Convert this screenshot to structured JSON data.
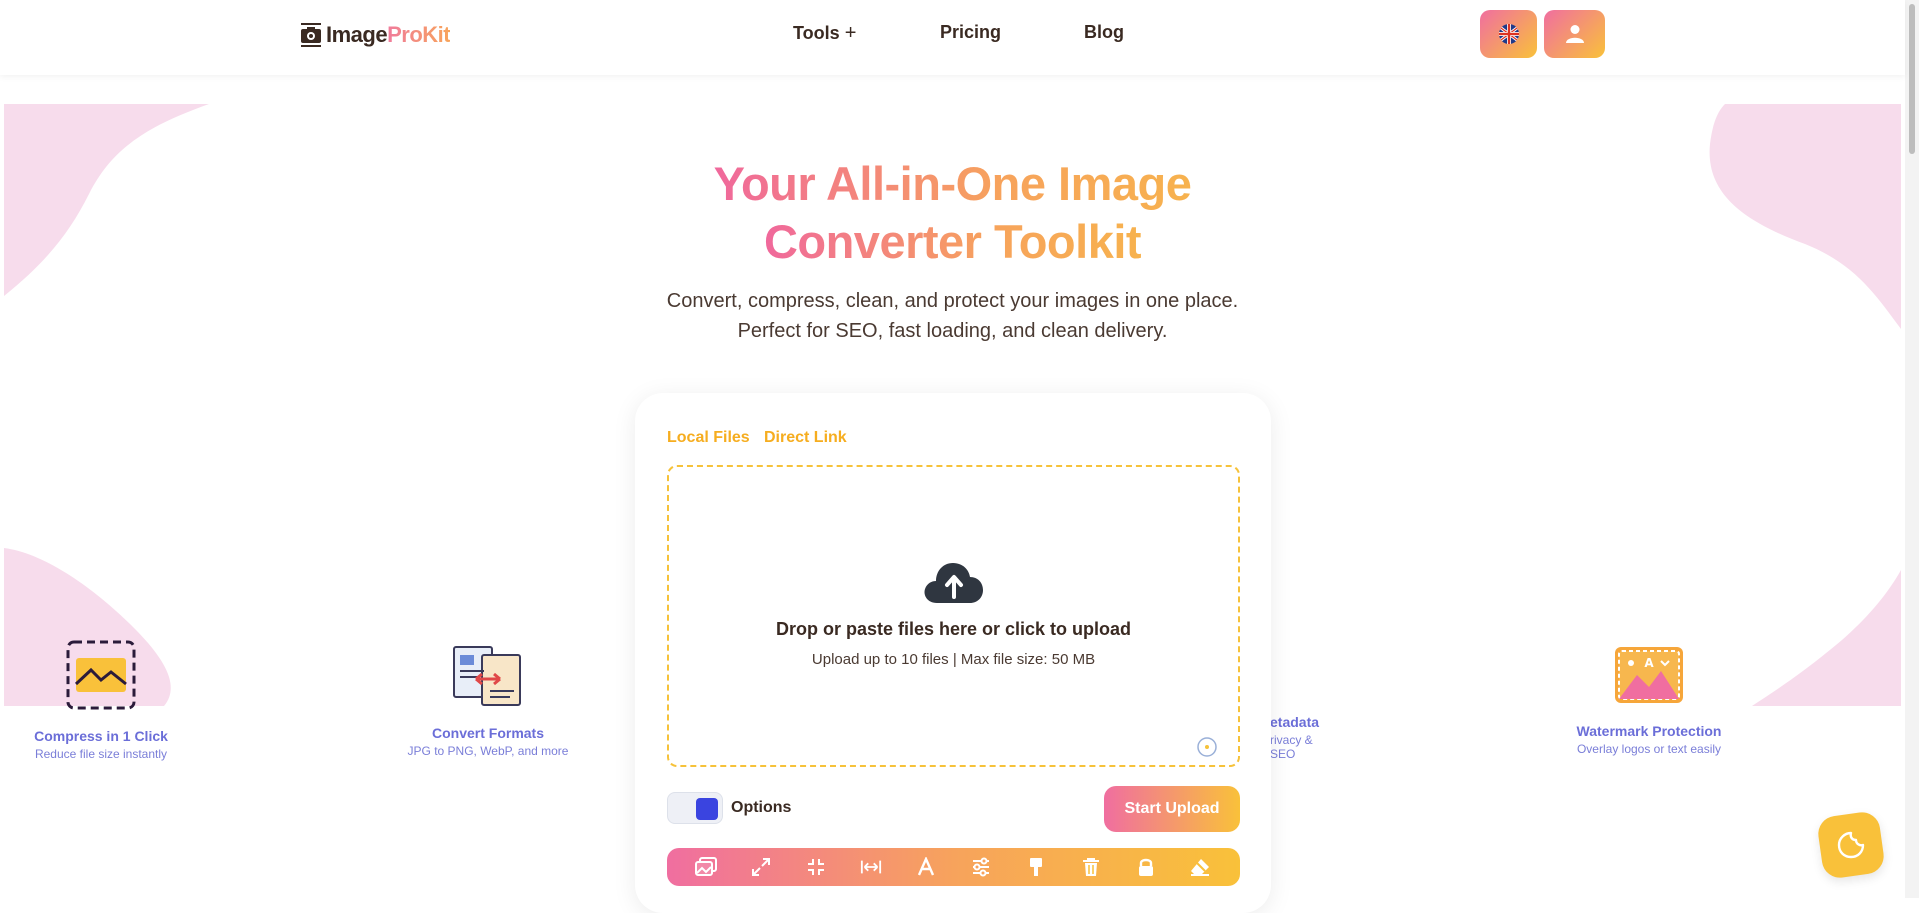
{
  "brand": {
    "part1": "Image",
    "part2": "ProKit"
  },
  "nav": {
    "tools": "Tools",
    "pricing": "Pricing",
    "blog": "Blog"
  },
  "hero": {
    "title_line1": "Your All-in-One Image",
    "title_line2": "Converter Toolkit",
    "sub_line1": "Convert, compress, clean, and protect your images in one place.",
    "sub_line2": "Perfect for SEO, fast loading, and clean delivery."
  },
  "uploader": {
    "tab_local": "Local Files",
    "tab_link": "Direct Link",
    "drop_title": "Drop or paste files here or click to upload",
    "drop_hint": "Upload up to 10 files | Max file size: 50 MB",
    "options_label": "Options",
    "start_label": "Start Upload"
  },
  "features": [
    {
      "title": "Compress in 1 Click",
      "desc": "Reduce file size instantly"
    },
    {
      "title": "Convert Formats",
      "desc": "JPG to PNG, WebP, and more"
    },
    {
      "title": "etadata",
      "desc": "rivacy & SEO"
    },
    {
      "title": "Watermark Protection",
      "desc": "Overlay logos or text easily"
    }
  ],
  "toolbar_icons": [
    "images-icon",
    "expand-icon",
    "compress-icon",
    "resize-width-icon",
    "text-icon",
    "sliders-icon",
    "brush-icon",
    "trash-icon",
    "lock-icon",
    "eraser-icon"
  ],
  "colors": {
    "pink": "#f06ea0",
    "orange": "#f7a35c",
    "yellow": "#f9c13a",
    "feature_text": "#6b6ed8"
  }
}
